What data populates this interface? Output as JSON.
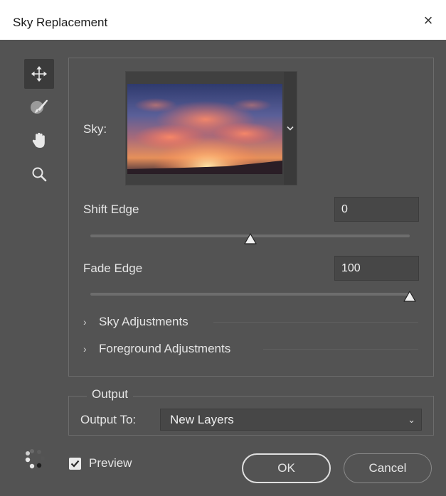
{
  "window": {
    "title": "Sky Replacement",
    "close_symbol": "×"
  },
  "tools": [
    {
      "name": "move-sky-tool",
      "icon": "move-arrows-icon",
      "active": true
    },
    {
      "name": "sky-brush-tool",
      "icon": "brush-icon",
      "active": false
    },
    {
      "name": "hand-tool",
      "icon": "hand-icon",
      "active": false
    },
    {
      "name": "zoom-tool",
      "icon": "zoom-magnifier-icon",
      "active": false
    }
  ],
  "sky": {
    "label": "Sky:",
    "dropdown_icon": "chevron-down-icon"
  },
  "shift_edge": {
    "label": "Shift Edge",
    "value": "0",
    "slider_fraction": 0.5
  },
  "fade_edge": {
    "label": "Fade Edge",
    "value": "100",
    "slider_fraction": 1.0
  },
  "sections": {
    "sky_adjustments": "Sky Adjustments",
    "foreground_adjustments": "Foreground Adjustments",
    "collapsed_icon": "chevron-right-icon"
  },
  "output": {
    "legend": "Output",
    "output_to_label": "Output To:",
    "output_to_value": "New Layers"
  },
  "footer": {
    "preview_label": "Preview",
    "preview_checked": true,
    "ok_label": "OK",
    "cancel_label": "Cancel"
  },
  "colors": {
    "dialog_bg": "#535353",
    "field_bg": "#474747",
    "text": "#e6e6e6",
    "title_bg": "#ffffff"
  }
}
